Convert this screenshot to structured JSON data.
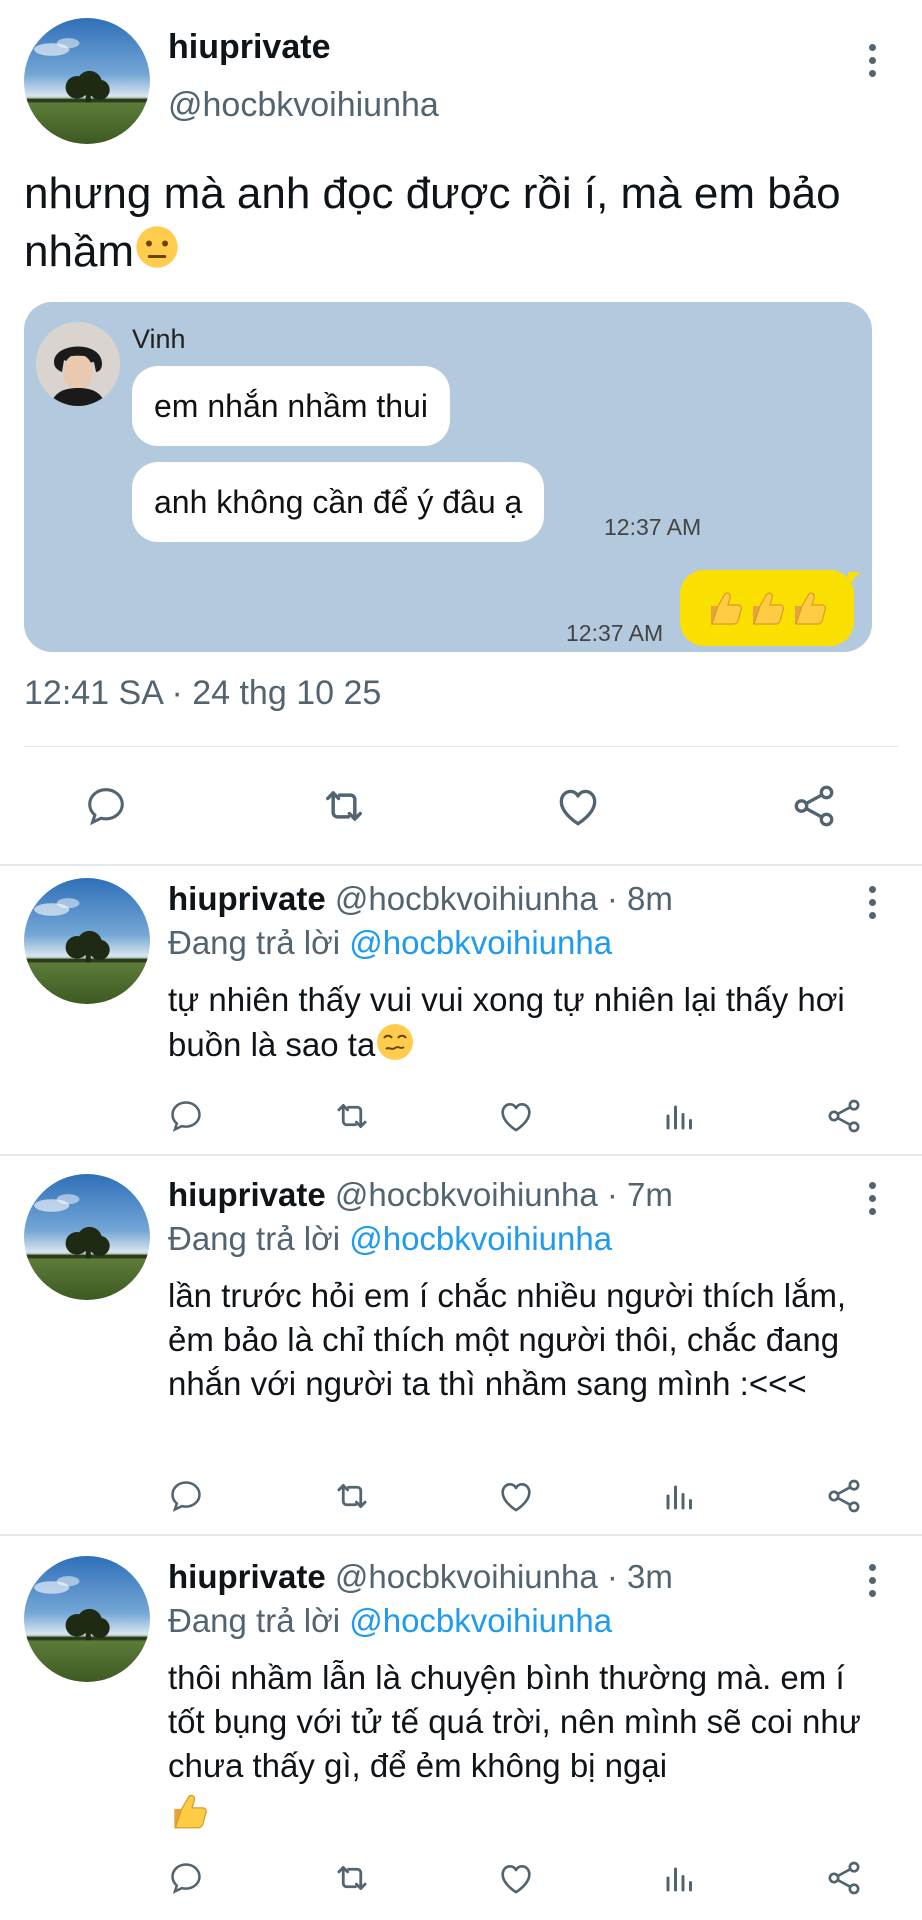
{
  "main_tweet": {
    "display_name": "hiuprivate",
    "handle": "@hocbkvoihiunha",
    "text": "nhưng mà anh đọc được rồi í, mà em bảo nhầm",
    "text_emoji": "neutral-face",
    "timestamp": "12:41 SA · 24 thg 10 25",
    "chat_screenshot": {
      "sender": "Vinh",
      "messages": [
        {
          "text": "em nhắn nhầm thui"
        },
        {
          "text": "anh không cần để ý đâu ạ",
          "time": "12:37 AM"
        }
      ],
      "my_reply": {
        "emoji": "thumbs-up x3",
        "time": "12:37 AM"
      },
      "colors": {
        "background": "#b3c9dd",
        "my_bubble": "#f9e000"
      }
    }
  },
  "replies": [
    {
      "display_name": "hiuprivate",
      "handle": "@hocbkvoihiunha",
      "time": "8m",
      "replying_label": "Đang trả lời",
      "replying_to": "@hocbkvoihiunha",
      "text": "tự nhiên thấy vui vui xong tự nhiên lại thấy hơi buồn là sao ta",
      "text_emoji": "woozy-face"
    },
    {
      "display_name": "hiuprivate",
      "handle": "@hocbkvoihiunha",
      "time": "7m",
      "replying_label": "Đang trả lời",
      "replying_to": "@hocbkvoihiunha",
      "text": "lần trước hỏi em í chắc nhiều người thích lắm, ẻm bảo là chỉ thích một người thôi, chắc đang nhắn với người ta thì nhầm sang mình :<<<"
    },
    {
      "display_name": "hiuprivate",
      "handle": "@hocbkvoihiunha",
      "time": "3m",
      "replying_label": "Đang trả lời",
      "replying_to": "@hocbkvoihiunha",
      "text": "thôi nhầm lẫn là chuyện bình thường mà. em í tốt bụng với tử tế quá trời, nên mình sẽ coi như chưa thấy gì, để ẻm không bị ngại",
      "text_emoji": "thumbs-up"
    }
  ],
  "sep": " · ",
  "colors": {
    "text": "#0f1419",
    "muted": "#536471",
    "link": "#1d9bf0",
    "divider": "#e6e9ec"
  },
  "icons": [
    "reply-icon",
    "retweet-icon",
    "like-icon",
    "views-icon",
    "share-icon",
    "more-icon"
  ]
}
